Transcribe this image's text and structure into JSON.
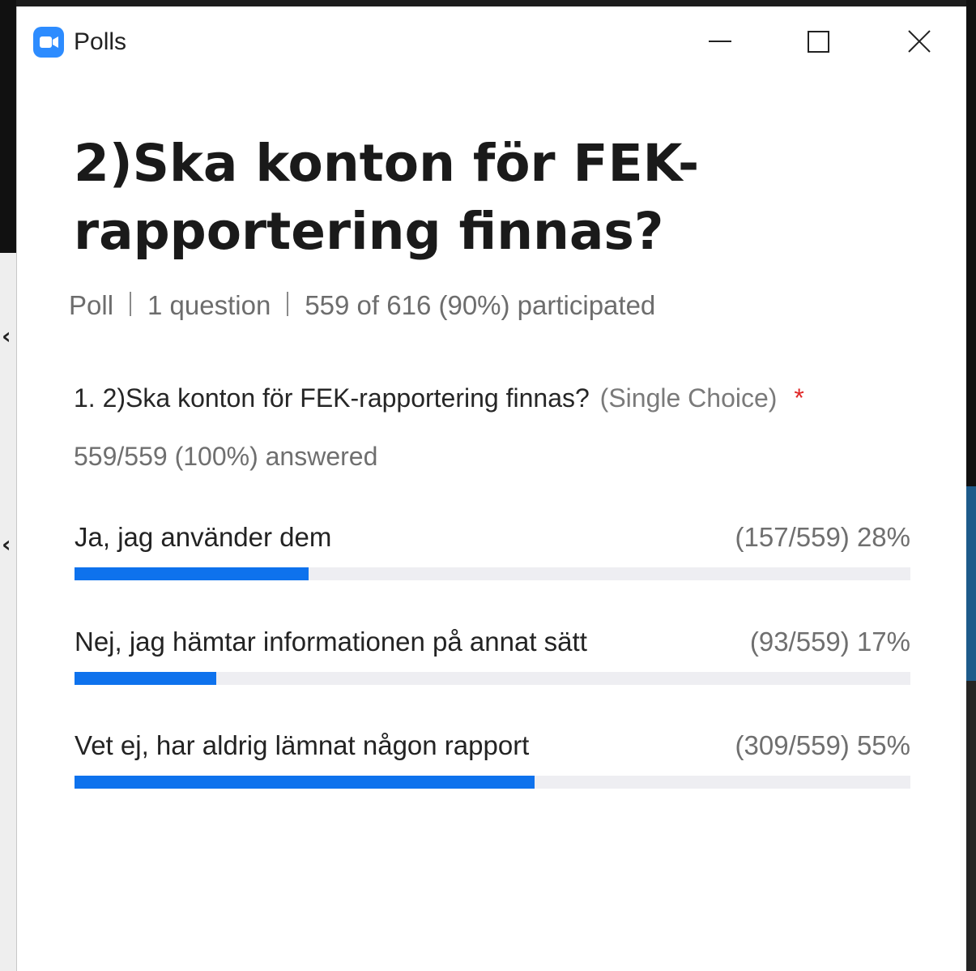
{
  "window": {
    "title": "Polls"
  },
  "poll": {
    "title": "2)Ska konton för FEK-rapportering finnas?",
    "meta": {
      "kind": "Poll",
      "questions": "1 question",
      "participation": "559 of 616 (90%) participated"
    },
    "question": {
      "text": "1. 2)Ska konton för FEK-rapportering finnas?",
      "type": "(Single Choice)",
      "required_mark": "*",
      "answered": "559/559 (100%) answered"
    },
    "options": [
      {
        "label": "Ja, jag använder dem",
        "result": "(157/559) 28%",
        "fraction": 0.28
      },
      {
        "label": "Nej, jag hämtar informationen på annat sätt",
        "result": "(93/559) 17%",
        "fraction": 0.17
      },
      {
        "label": "Vet ej, har aldrig lämnat någon rapport",
        "result": "(309/559) 55%",
        "fraction": 0.55
      }
    ]
  },
  "colors": {
    "accent": "#0e72ed",
    "track": "#eeeef2",
    "required": "#e02828",
    "app_icon": "#2d8cff"
  },
  "icons": {
    "app": "zoom-camera-icon",
    "minimize": "minimize-icon",
    "maximize": "maximize-icon",
    "close": "close-icon"
  }
}
